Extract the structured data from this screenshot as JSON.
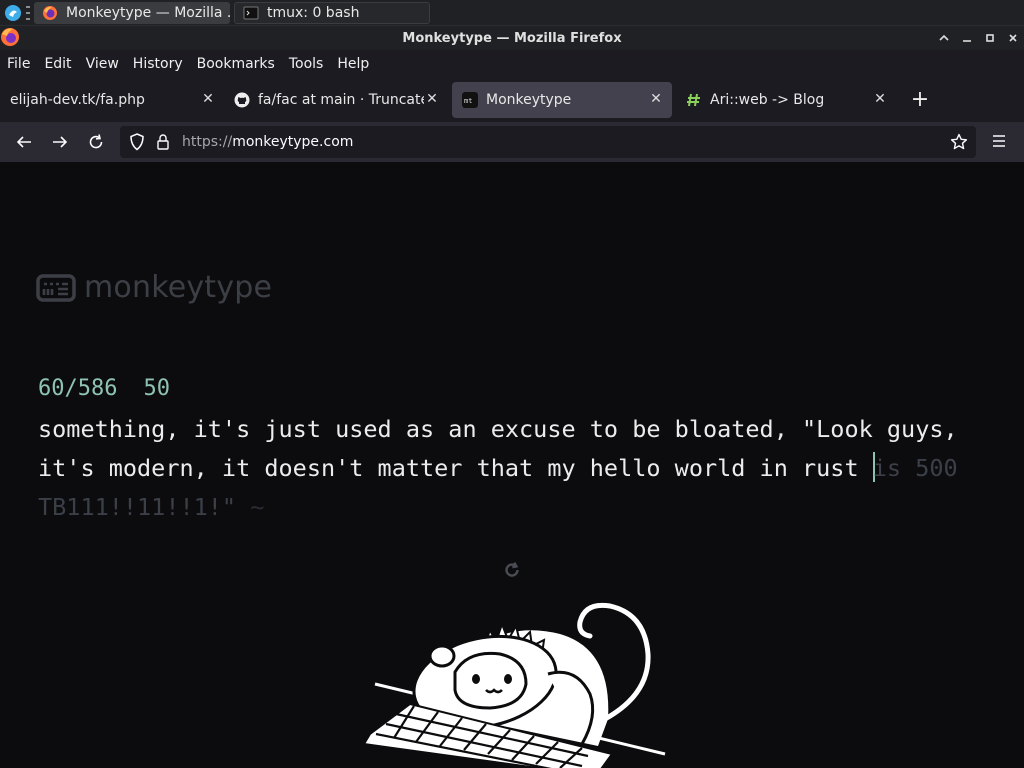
{
  "taskbar": {
    "tasks": [
      {
        "label": "Monkeytype — Mozilla ..."
      },
      {
        "label": "tmux: 0 bash"
      }
    ]
  },
  "window": {
    "title": "Monkeytype — Mozilla Firefox"
  },
  "menubar": {
    "items": [
      {
        "label": "File"
      },
      {
        "label": "Edit"
      },
      {
        "label": "View"
      },
      {
        "label": "History"
      },
      {
        "label": "Bookmarks"
      },
      {
        "label": "Tools"
      },
      {
        "label": "Help"
      }
    ]
  },
  "tabs": [
    {
      "label": "elijah-dev.tk/fa.php",
      "icon": "firefox-icon"
    },
    {
      "label": "fa/fac at main · Truncated",
      "icon": "github-icon"
    },
    {
      "label": "Monkeytype",
      "icon": "monkeytype-icon"
    },
    {
      "label": "Ari::web -> Blog",
      "icon": "hash-icon"
    }
  ],
  "navbar": {
    "url_scheme": "https://",
    "url_host": "monkeytype.com"
  },
  "page": {
    "logo_text": "monkeytype",
    "word_progress": "60/586",
    "wpm": "50",
    "text_typed_1": "something, it's just used as an excuse to be bloated, \"Look guys,",
    "text_typed_2a": "it's modern, it doesn't matter that my hello world in rust ",
    "text_untyped_2": "is 500",
    "text_untyped_3": "TB111!!11!!1!\"",
    "text_faded_3": " ~"
  },
  "colors": {
    "accent": "#8fc3b1",
    "background": "#0c0c0e",
    "text": "#ececec",
    "subtext": "#3b3f47"
  }
}
